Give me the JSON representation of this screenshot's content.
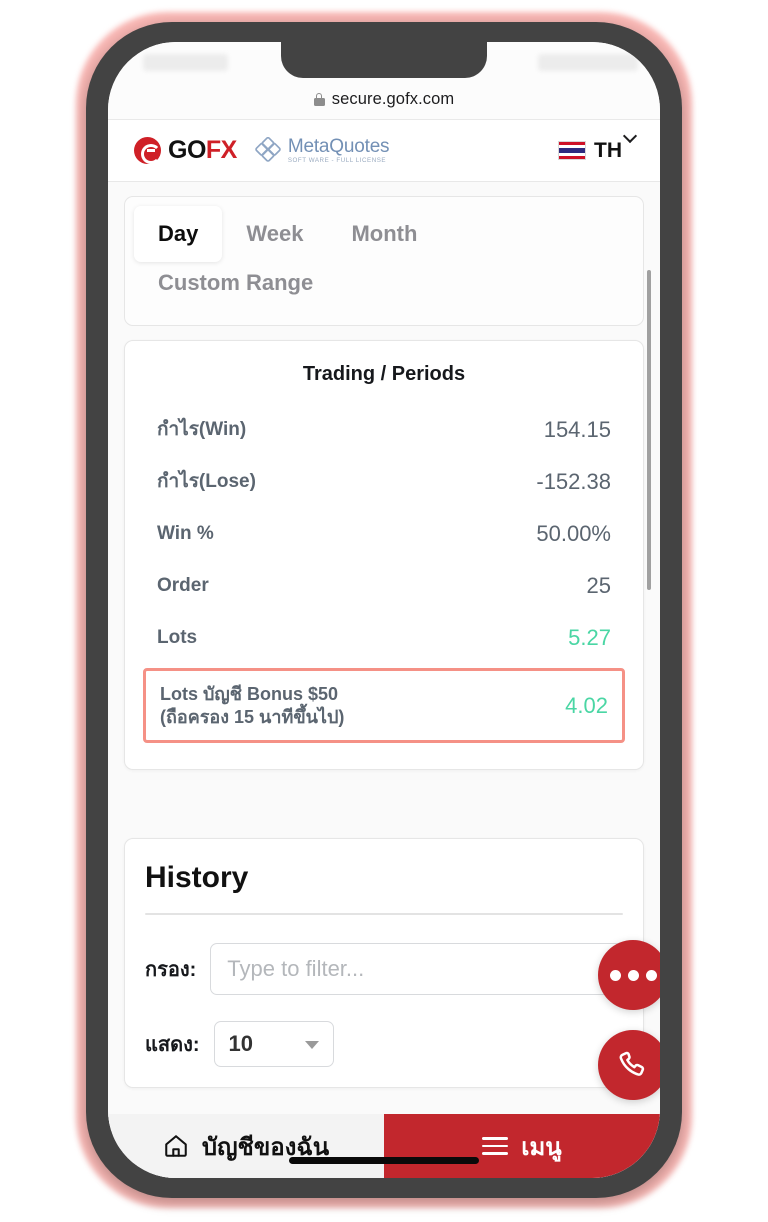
{
  "browser": {
    "url": "secure.gofx.com",
    "lock_icon": "lock-icon"
  },
  "header": {
    "brand_go": "GO",
    "brand_fx": "FX",
    "partner_name": "MetaQuotes",
    "partner_tagline": "SOFT WARE - FULL LICENSE",
    "language_code": "TH",
    "flag_icon": "thai-flag-icon",
    "chevron_icon": "chevron-down-icon"
  },
  "period_tabs": [
    {
      "label": "Day",
      "active": true
    },
    {
      "label": "Week",
      "active": false
    },
    {
      "label": "Month",
      "active": false
    },
    {
      "label": "Custom Range",
      "active": false
    }
  ],
  "stats": {
    "title": "Trading / Periods",
    "rows": [
      {
        "label": "กำไร(Win)",
        "value": "154.15",
        "green": false,
        "highlight": false
      },
      {
        "label": "กำไร(Lose)",
        "value": "-152.38",
        "green": false,
        "highlight": false
      },
      {
        "label": "Win %",
        "value": "50.00%",
        "green": false,
        "highlight": false
      },
      {
        "label": "Order",
        "value": "25",
        "green": false,
        "highlight": false
      },
      {
        "label": "Lots",
        "value": "5.27",
        "green": true,
        "highlight": false
      }
    ],
    "bonus_row": {
      "label_line1": "Lots บัญชี Bonus $50",
      "label_line2": "(ถือครอง 15 นาทีขึ้นไป)",
      "value": "4.02"
    }
  },
  "history": {
    "title": "History",
    "filter_label": "กรอง:",
    "filter_value": "",
    "filter_placeholder": "Type to filter...",
    "show_label": "แสดง:",
    "show_value": "10"
  },
  "fabs": {
    "more_icon": "ellipsis-icon",
    "call_icon": "phone-icon"
  },
  "bottom_nav": {
    "account_label": "บัญชีของฉัน",
    "account_icon": "home-icon",
    "menu_label": "เมนู",
    "menu_icon": "hamburger-icon"
  },
  "colors": {
    "brand_red": "#c2272d",
    "logo_red": "#cf2027",
    "green_value": "#4ad6a4",
    "highlight_border": "#f59186",
    "label_gray": "#5b6570",
    "partner_blue": "#7390b5"
  }
}
